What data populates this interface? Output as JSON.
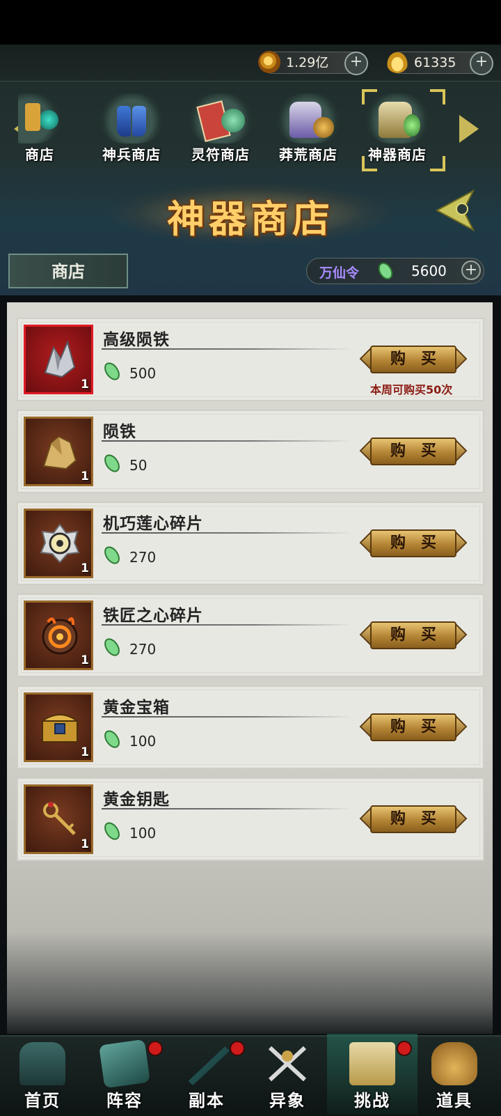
{
  "currency": {
    "coins": {
      "value": "1.29亿",
      "icon": "coin-icon"
    },
    "ingots": {
      "value": "61335",
      "icon": "gold-ingot-icon"
    }
  },
  "shop_tabs": [
    {
      "label": "商店",
      "icon": "shop-icon"
    },
    {
      "label": "神兵商店",
      "icon": "boots-icon"
    },
    {
      "label": "灵符商店",
      "icon": "talisman-icon"
    },
    {
      "label": "莽荒商店",
      "icon": "armor-icon"
    },
    {
      "label": "神器商店",
      "icon": "artifact-icon",
      "selected": true
    }
  ],
  "shop_title": "神器商店",
  "sub_tab": "商店",
  "token": {
    "label": "万仙令",
    "value": "5600",
    "icon": "jade-token-icon"
  },
  "items": [
    {
      "name": "高级陨铁",
      "price": "500",
      "qty": "1",
      "buy_label": "购买",
      "limit": "本周可购买50次",
      "selected": true,
      "icon": "advanced-meteor-iron-icon"
    },
    {
      "name": "陨铁",
      "price": "50",
      "qty": "1",
      "buy_label": "购买",
      "icon": "meteor-iron-icon"
    },
    {
      "name": "机巧莲心碎片",
      "price": "270",
      "qty": "1",
      "buy_label": "购买",
      "icon": "lotus-core-fragment-icon"
    },
    {
      "name": "铁匠之心碎片",
      "price": "270",
      "qty": "1",
      "buy_label": "购买",
      "icon": "blacksmith-heart-fragment-icon"
    },
    {
      "name": "黄金宝箱",
      "price": "100",
      "qty": "1",
      "buy_label": "购买",
      "icon": "gold-chest-icon"
    },
    {
      "name": "黄金钥匙",
      "price": "100",
      "qty": "1",
      "buy_label": "购买",
      "icon": "gold-key-icon"
    }
  ],
  "nav": [
    {
      "label": "首页",
      "icon": "home-pavilion-icon",
      "badge": false
    },
    {
      "label": "阵容",
      "icon": "lineup-book-icon",
      "badge": true
    },
    {
      "label": "副本",
      "icon": "dungeon-sword-icon",
      "badge": true
    },
    {
      "label": "异象",
      "icon": "crossed-swords-icon",
      "badge": false
    },
    {
      "label": "挑战",
      "icon": "challenge-scroll-icon",
      "badge": true,
      "selected": true
    },
    {
      "label": "道具",
      "icon": "item-bag-icon",
      "badge": false
    }
  ],
  "colors": {
    "accent_gold": "#d9c55a",
    "title_gold": "#ffcf6a",
    "limit_red": "#8b1c12",
    "selected_border": "#e01b24",
    "badge_red": "#d11a1a"
  }
}
